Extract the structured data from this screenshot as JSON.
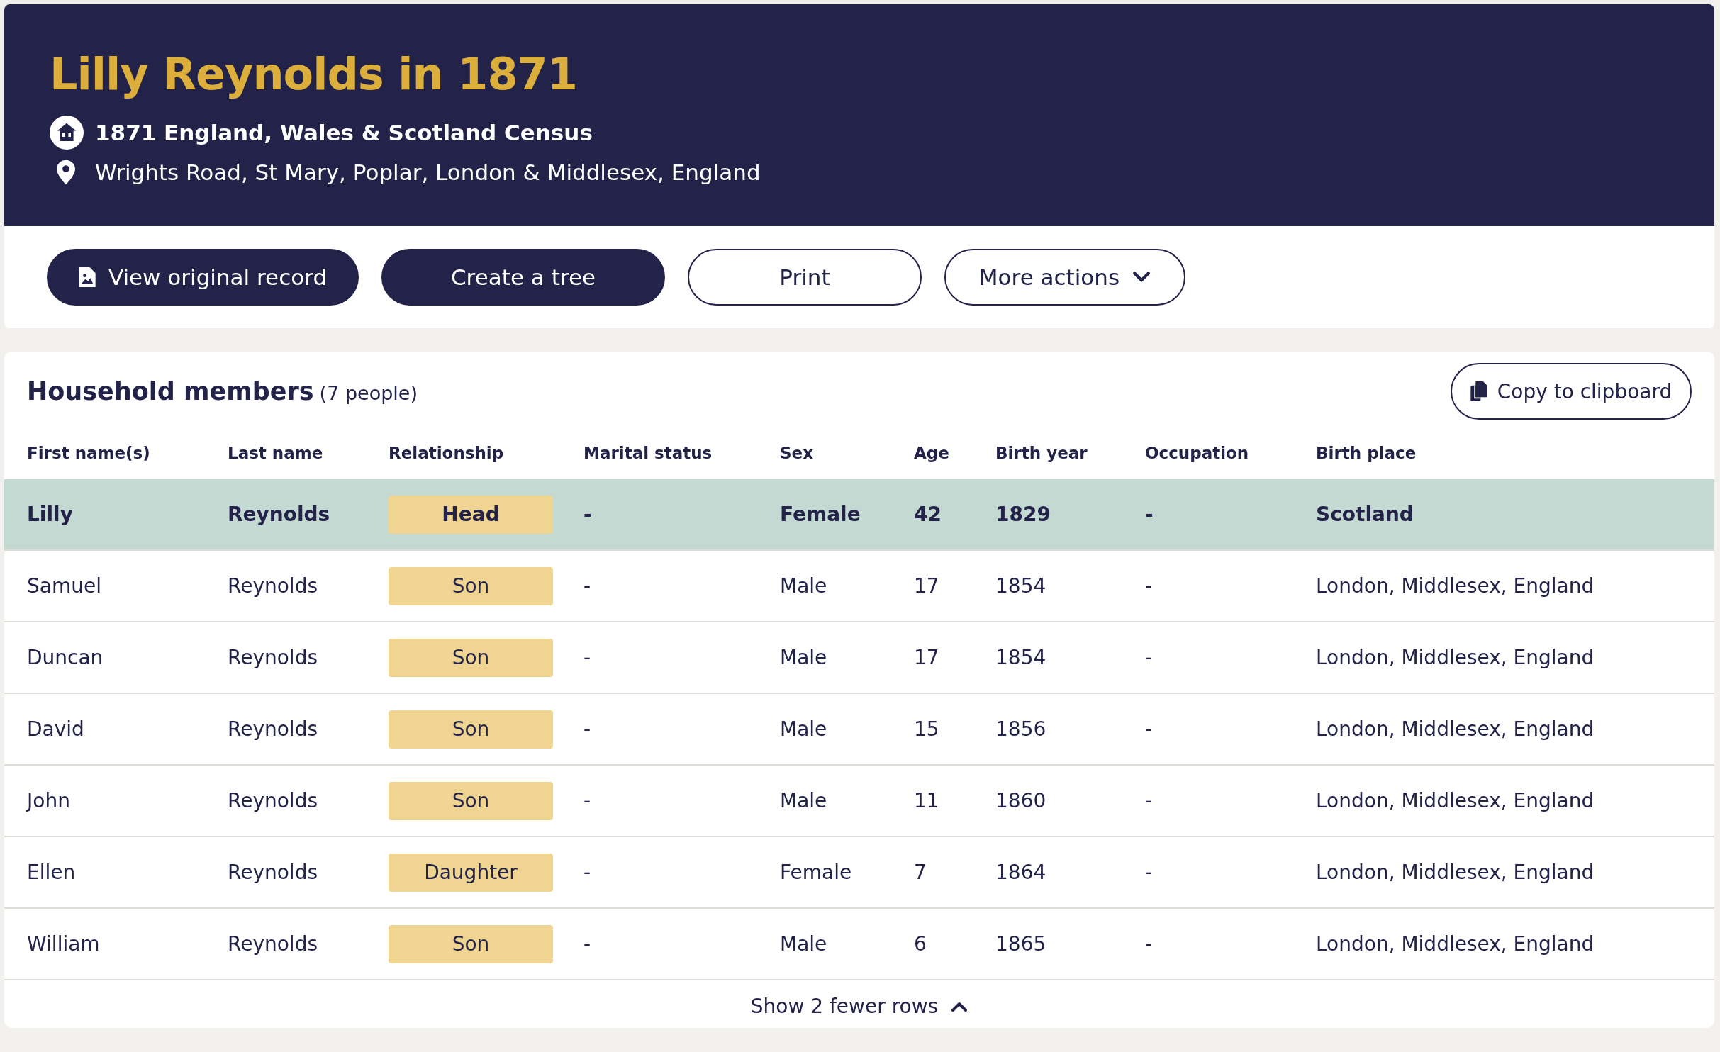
{
  "header": {
    "title": "Lilly Reynolds in 1871",
    "collection": "1871 England, Wales & Scotland Census",
    "location": "Wrights Road, St Mary, Poplar, London & Middlesex, England"
  },
  "actions": [
    {
      "label": "View original record",
      "kind": "primary-icon"
    },
    {
      "label": "Create a tree",
      "kind": "primary"
    },
    {
      "label": "Print",
      "kind": "outline"
    },
    {
      "label": "More actions",
      "kind": "dropdown"
    }
  ],
  "household": {
    "title": "Household members",
    "count": "(7 people)",
    "copy_button": "Copy to clipboard",
    "columns": [
      "First name(s)",
      "Last name",
      "Relationship",
      "Marital status",
      "Sex",
      "Age",
      "Birth year",
      "Occupation",
      "Birth place"
    ],
    "rows": [
      {
        "cells": [
          "Lilly",
          "Reynolds",
          "Head",
          "-",
          "Female",
          "42",
          "1829",
          "-",
          "Scotland"
        ],
        "selected": true
      },
      {
        "cells": [
          "Samuel",
          "Reynolds",
          "Son",
          "-",
          "Male",
          "17",
          "1854",
          "-",
          "London, Middlesex, England"
        ],
        "selected": false
      },
      {
        "cells": [
          "Duncan",
          "Reynolds",
          "Son",
          "-",
          "Male",
          "17",
          "1854",
          "-",
          "London, Middlesex, England"
        ],
        "selected": false
      },
      {
        "cells": [
          "David",
          "Reynolds",
          "Son",
          "-",
          "Male",
          "15",
          "1856",
          "-",
          "London, Middlesex, England"
        ],
        "selected": false
      },
      {
        "cells": [
          "John",
          "Reynolds",
          "Son",
          "-",
          "Male",
          "11",
          "1860",
          "-",
          "London, Middlesex, England"
        ],
        "selected": false
      },
      {
        "cells": [
          "Ellen",
          "Reynolds",
          "Daughter",
          "-",
          "Female",
          "7",
          "1864",
          "-",
          "London, Middlesex, England"
        ],
        "selected": false
      },
      {
        "cells": [
          "William",
          "Reynolds",
          "Son",
          "-",
          "Male",
          "6",
          "1865",
          "-",
          "London, Middlesex, England"
        ],
        "selected": false
      }
    ],
    "toggle": "Show 2 fewer rows"
  }
}
